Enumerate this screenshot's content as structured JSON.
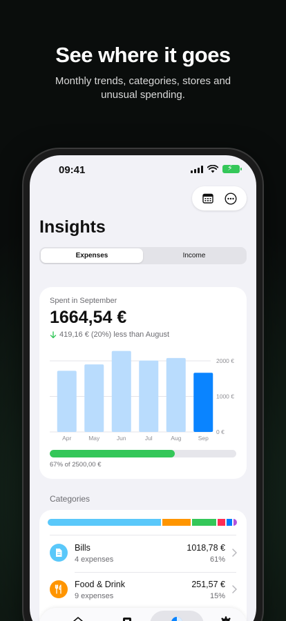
{
  "promo": {
    "title": "See where it goes",
    "subtitle": "Monthly trends, categories, stores and unusual spending."
  },
  "status_bar": {
    "time": "09:41"
  },
  "toolbar": {
    "icons": [
      "calendar-icon",
      "more-icon"
    ]
  },
  "page": {
    "title": "Insights"
  },
  "segment": {
    "options": [
      "Expenses",
      "Income"
    ],
    "selected": "Expenses"
  },
  "spending": {
    "label": "Spent in September",
    "amount": "1664,54 €",
    "delta": "419,16 € (20%) less than August",
    "budget_fraction": 0.67,
    "budget_label": "67% of 2500,00 €"
  },
  "chart_data": {
    "type": "bar",
    "categories": [
      "Apr",
      "May",
      "Jun",
      "Jul",
      "Aug",
      "Sep"
    ],
    "values": [
      1720,
      1900,
      2280,
      2010,
      2080,
      1664.54
    ],
    "highlight_index": 5,
    "ylim": [
      0,
      2000
    ],
    "y_ticks": [
      "2000 €",
      "1000 €",
      "0 €"
    ],
    "colors": {
      "bar": "#b9dcfd",
      "highlight": "#0a84ff",
      "grid": "#e3e3e8"
    }
  },
  "categories": {
    "title": "Categories",
    "breakdown_colors": [
      "#5ac8fa",
      "#ff9500",
      "#34c759",
      "#ff2d55",
      "#007aff",
      "#af52de"
    ],
    "breakdown_fractions": [
      0.61,
      0.15,
      0.13,
      0.04,
      0.03,
      0.02
    ],
    "items": [
      {
        "name": "Bills",
        "count": "4 expenses",
        "amount": "1018,78 €",
        "percent": "61%",
        "color": "#5ac8fa",
        "icon": "document-icon"
      },
      {
        "name": "Food & Drink",
        "count": "9 expenses",
        "amount": "251,57 €",
        "percent": "15%",
        "color": "#ff9500",
        "icon": "fork-knife-icon"
      }
    ]
  },
  "tabbar": {
    "icons": [
      "home-icon",
      "wallet-icon",
      "pie-chart-icon",
      "gear-icon"
    ],
    "selected": 2
  }
}
